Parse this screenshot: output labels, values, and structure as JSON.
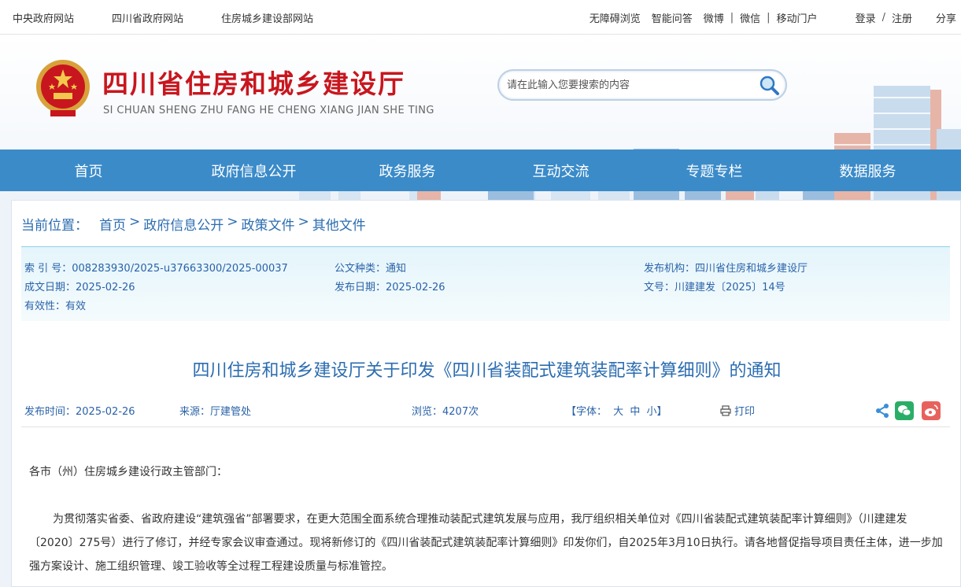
{
  "topbar": {
    "left_links": [
      "中央政府网站",
      "四川省政府网站",
      "住房城乡建设部网站"
    ],
    "accessible": "无障碍浏览",
    "qa": "智能问答",
    "weibo": "微博",
    "wechat": "微信",
    "mobile": "移动门户",
    "login": "登录",
    "slash": "/",
    "register": "注册",
    "share": "分享"
  },
  "header": {
    "title": "四川省住房和城乡建设厅",
    "subtitle": "SI CHUAN SHENG ZHU FANG HE CHENG XIANG JIAN SHE TING",
    "search_placeholder": "请在此输入您要搜索的内容"
  },
  "nav": {
    "items": [
      "首页",
      "政府信息公开",
      "政务服务",
      "互动交流",
      "专题专栏",
      "数据服务"
    ]
  },
  "breadcrumb": {
    "label": "当前位置：",
    "items": [
      "首页",
      "政府信息公开",
      "政策文件",
      "其他文件"
    ],
    "sep": ">"
  },
  "meta": {
    "index_no": "索 引 号：008283930/2025-u37663300/2025-00037",
    "doc_type": "公文种类：通知",
    "publisher": "发布机构：四川省住房和城乡建设厅",
    "written_date": "成文日期：2025-02-26",
    "publish_date": "发布日期：2025-02-26",
    "doc_no": "文号：川建建发〔2025〕14号",
    "validity": "有效性：有效"
  },
  "article": {
    "title": "四川住房和城乡建设厅关于印发《四川省装配式建筑装配率计算细则》的通知",
    "publish_time": "发布时间：2025-02-26",
    "source": "来源：厅建管处",
    "views": "浏览：4207次",
    "font_label": "【字体：",
    "font_large": "大",
    "font_medium": "中",
    "font_small": "小】",
    "print": "打印",
    "salutation": "各市（州）住房城乡建设行政主管部门：",
    "paragraph_1": "为贯彻落实省委、省政府建设“建筑强省”部署要求，在更大范围全面系统合理推动装配式建筑发展与应用，我厅组织相关单位对《四川省装配式建筑装配率计算细则》（川建建发〔2020〕275号）进行了修订，并经专家会议审查通过。现将新修订的《四川省装配式建筑装配率计算细则》印发你们，自2025年3月10日执行。请各地督促指导项目责任主体，进一步加强方案设计、施工组织管理、竣工验收等全过程工程建设质量与标准管控。"
  },
  "colors": {
    "nav_bg": "#3b8bc9",
    "title_red": "#c8161e",
    "link_blue": "#2c6db0",
    "wechat_green": "#2aae67",
    "weibo_red": "#e8625d",
    "share_blue": "#3a8fd6"
  },
  "icons": [
    "search-icon",
    "print-icon",
    "share-icon",
    "wechat-icon",
    "weibo-icon",
    "national-emblem-icon"
  ]
}
